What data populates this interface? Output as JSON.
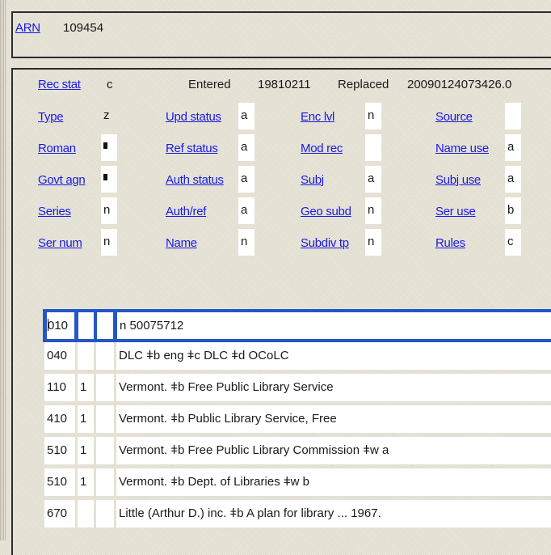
{
  "arn": {
    "label": "ARN",
    "value": "109454"
  },
  "header": {
    "rec_stat_label": "Rec stat",
    "rec_stat_value": "c",
    "entered_label": "Entered",
    "entered_value": "19810211",
    "replaced_label": "Replaced",
    "replaced_value": "20090124073426.0"
  },
  "fixed_fields": {
    "col1": [
      {
        "label": "Type",
        "value": "z"
      },
      {
        "label": "Roman",
        "value": "■"
      },
      {
        "label": "Govt agn",
        "value": "■"
      },
      {
        "label": "Series",
        "value": "n"
      },
      {
        "label": "Ser num",
        "value": "n"
      }
    ],
    "col2": [
      {
        "label": "Upd status",
        "value": "a"
      },
      {
        "label": "Ref status",
        "value": "a"
      },
      {
        "label": "Auth status",
        "value": "a"
      },
      {
        "label": "Auth/ref",
        "value": "a"
      },
      {
        "label": "Name",
        "value": "n"
      }
    ],
    "col3": [
      {
        "label": "Enc lvl",
        "value": "n"
      },
      {
        "label": "Mod rec",
        "value": ""
      },
      {
        "label": "Subj",
        "value": "a"
      },
      {
        "label": "Geo subd",
        "value": "n"
      },
      {
        "label": "Subdiv tp",
        "value": "n"
      }
    ],
    "col4": [
      {
        "label": "Source",
        "value": ""
      },
      {
        "label": "Name use",
        "value": "a"
      },
      {
        "label": "Subj use",
        "value": "a"
      },
      {
        "label": "Ser use",
        "value": "b"
      },
      {
        "label": "Rules",
        "value": "c"
      }
    ]
  },
  "marc_fields": [
    {
      "tag": "010",
      "ind1": "",
      "ind2": "",
      "data": "n  50075712",
      "selected": true
    },
    {
      "tag": "040",
      "ind1": "",
      "ind2": "",
      "data": "DLC ǂb eng ǂc DLC ǂd OCoLC"
    },
    {
      "tag": "110",
      "ind1": "1",
      "ind2": "",
      "data": "Vermont. ǂb Free Public Library Service"
    },
    {
      "tag": "410",
      "ind1": "1",
      "ind2": "",
      "data": "Vermont. ǂb Public Library Service, Free"
    },
    {
      "tag": "510",
      "ind1": "1",
      "ind2": "",
      "data": "Vermont. ǂb Free Public Library Commission ǂw a"
    },
    {
      "tag": "510",
      "ind1": "1",
      "ind2": "",
      "data": "Vermont. ǂb Dept. of Libraries ǂw b"
    },
    {
      "tag": "670",
      "ind1": "",
      "ind2": "",
      "data": "Little (Arthur D.) inc. ǂb A plan for library ... 1967."
    }
  ],
  "colors": {
    "link": "#1a1ae6",
    "selection": "#2456c6",
    "background": "#e6e3d6"
  }
}
